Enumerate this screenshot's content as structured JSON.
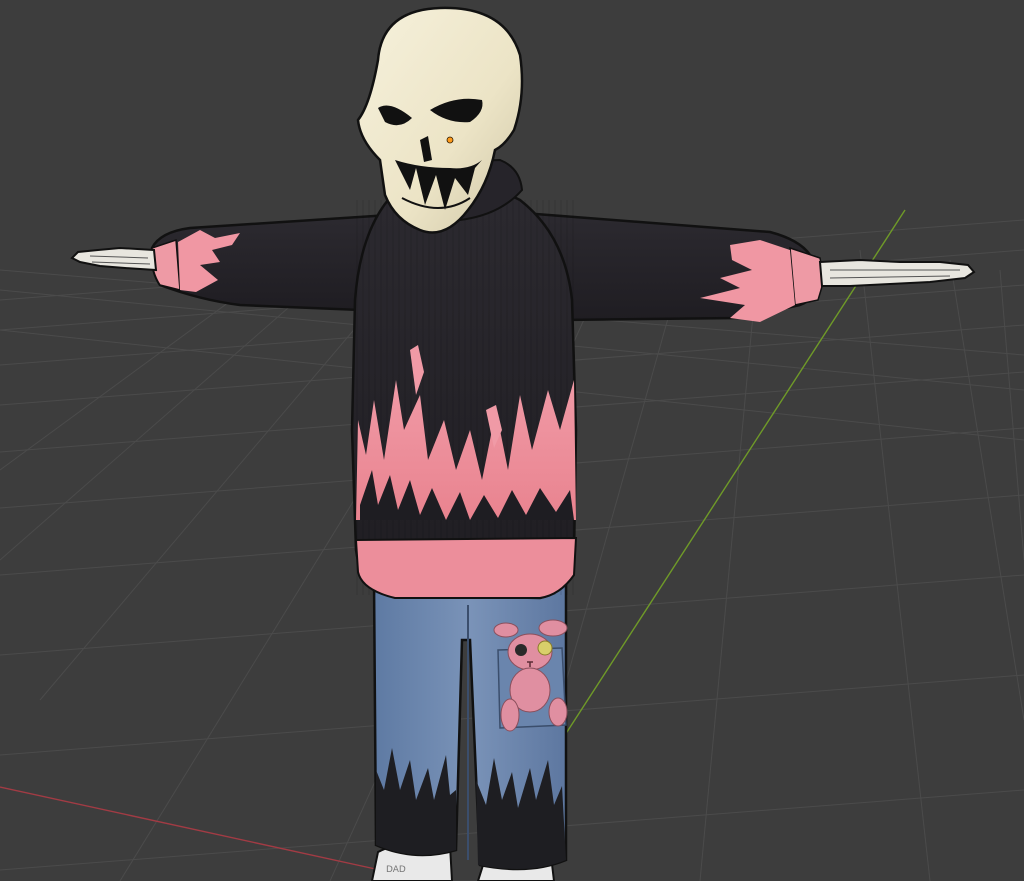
{
  "viewport": {
    "background": "#3d3d3d",
    "grid_line_color": "#4a4a4a",
    "x_axis_color": "#a23b44",
    "y_axis_color": "#6f9a28"
  },
  "character": {
    "skull_color": "#f0ead2",
    "sweater_color": "#262428",
    "flame_color": "#f097a3",
    "cuff_color": "#ee9aa5",
    "jeans_color": "#6d88b0",
    "jeans_flame_color": "#1e1e22",
    "bones_color": "#e8e6df",
    "bunny_color": "#e08fa1",
    "origin_color": "#ff9a1a"
  }
}
